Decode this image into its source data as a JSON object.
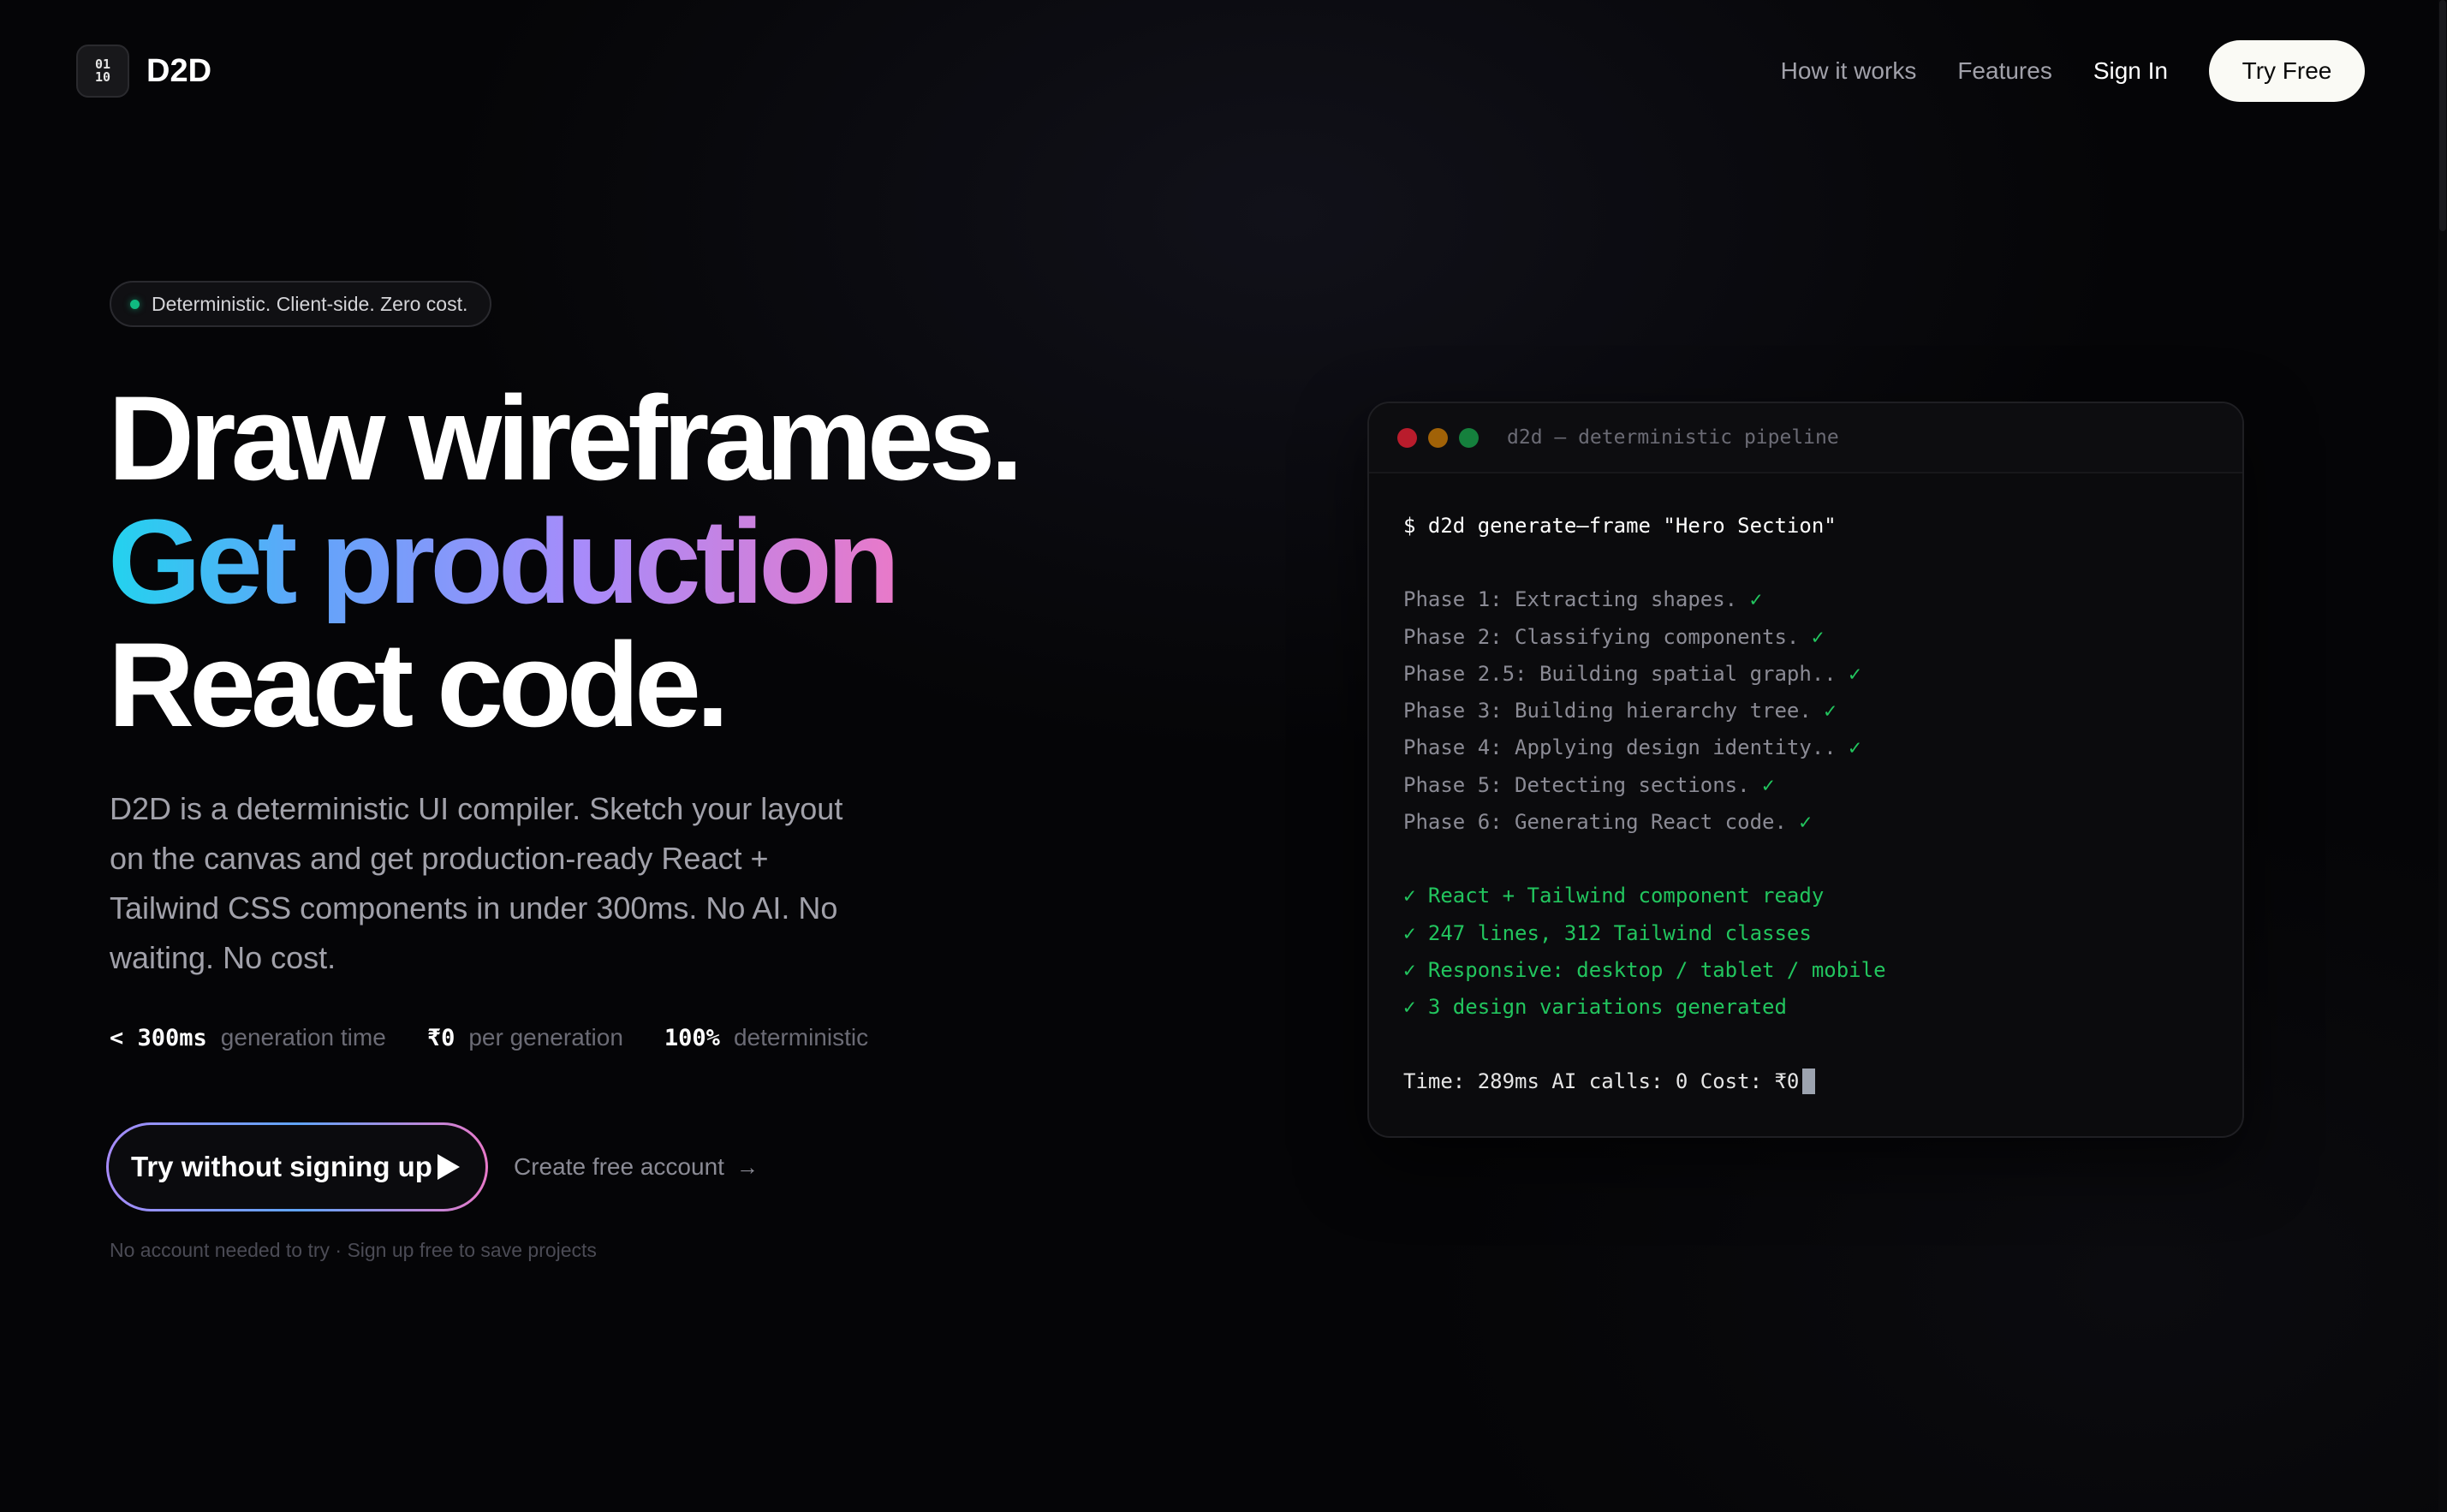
{
  "nav": {
    "logo_icon_top": "01",
    "logo_icon_bottom": "10",
    "brand": "D2D",
    "links": [
      {
        "label": "How it works"
      },
      {
        "label": "Features"
      },
      {
        "label": "Sign In"
      }
    ],
    "cta_label": "Try Free"
  },
  "hero": {
    "badge": "Deterministic. Client-side. Zero cost.",
    "headline_line1": "Draw wireframes.",
    "headline_line2": "Get production",
    "headline_line3": "React code.",
    "description": "D2D is a deterministic UI compiler. Sketch your layout on the canvas and get production-ready React + Tailwind CSS components in under 300ms. No AI. No waiting. No cost.",
    "stats": [
      {
        "value": "< 300ms",
        "label": "generation time"
      },
      {
        "value": "₹0",
        "label": "per generation"
      },
      {
        "value": "100%",
        "label": "deterministic"
      }
    ],
    "primary_cta": "Try without signing up",
    "secondary_cta": "Create free account",
    "footnote": "No account needed to try · Sign up free to save projects"
  },
  "terminal": {
    "title": "d2d — deterministic pipeline",
    "command": "$ d2d generate—frame \"Hero Section\"",
    "phases": [
      {
        "text": "Phase 1: Extracting shapes. ",
        "check": "✓"
      },
      {
        "text": "Phase 2: Classifying components. ",
        "check": "✓"
      },
      {
        "text": "Phase 2.5: Building spatial graph.. ",
        "check": "✓"
      },
      {
        "text": "Phase 3: Building hierarchy tree. ",
        "check": "✓"
      },
      {
        "text": "Phase 4: Applying design identity.. ",
        "check": "✓"
      },
      {
        "text": "Phase 5: Detecting sections. ",
        "check": "✓"
      },
      {
        "text": "Phase 6: Generating React code. ",
        "check": "✓"
      }
    ],
    "results": [
      "✓ React + Tailwind component ready",
      "✓ 247 lines, 312 Tailwind classes",
      "✓ Responsive: desktop / tablet / mobile",
      "✓ 3 design variations generated"
    ],
    "footer": "Time: 289ms AI calls: 0 Cost: ₹0"
  },
  "colors": {
    "background": "#050507",
    "accent_green": "#22c55e",
    "gradient_start": "#22d3ee",
    "gradient_mid": "#a78bfa",
    "gradient_end": "#e879c9"
  }
}
